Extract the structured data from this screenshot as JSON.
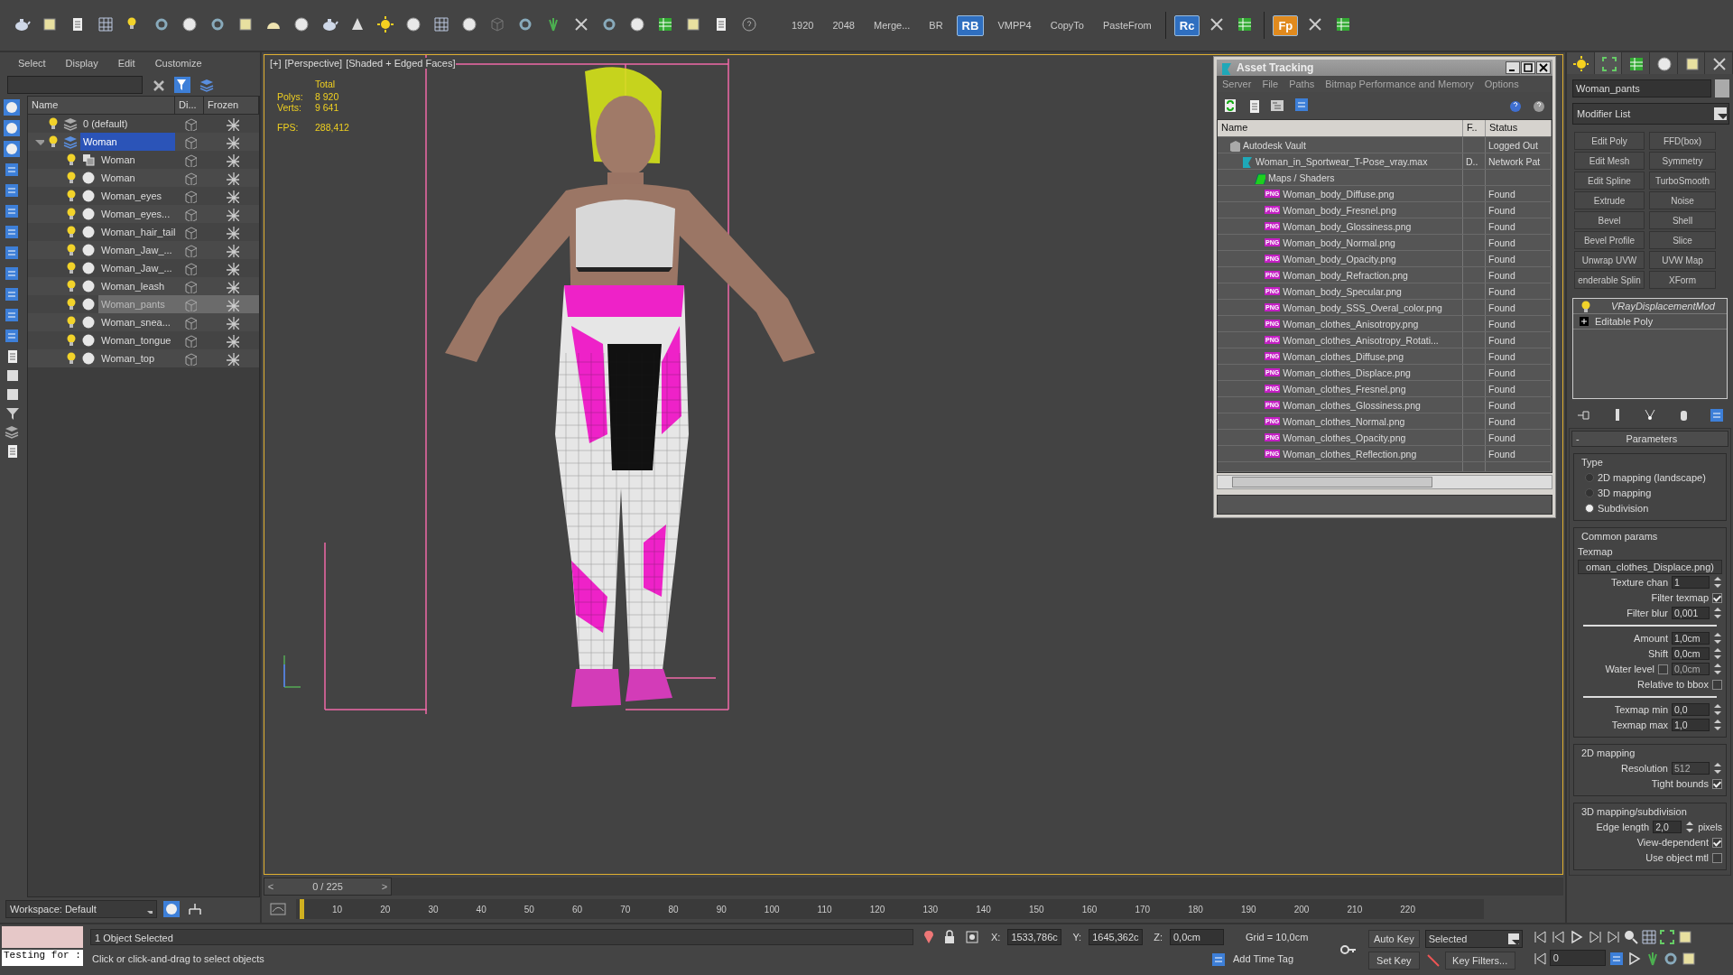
{
  "toolbar": {
    "buttons": [
      {
        "label": "1920",
        "kind": "text"
      },
      {
        "label": "2048",
        "kind": "text"
      },
      {
        "label": "Merge...",
        "kind": "text"
      },
      {
        "label": "BR",
        "kind": "text"
      },
      {
        "label": "RB",
        "kind": "badge"
      },
      {
        "label": "VMPP4",
        "kind": "text"
      },
      {
        "label": "CopyTo",
        "kind": "text"
      },
      {
        "label": "PasteFrom",
        "kind": "text"
      }
    ],
    "plugins": [
      {
        "label": "Rc",
        "color": "#2f6fc0"
      },
      {
        "label": "Fp",
        "color": "#e08a1e"
      }
    ]
  },
  "scene_explorer": {
    "menu": [
      "Select",
      "Display",
      "Edit",
      "Customize"
    ],
    "columns": [
      "Name",
      "Di...",
      "Frozen"
    ],
    "tree": [
      {
        "name": "0 (default)",
        "kind": "layer",
        "selected": false,
        "active": false
      },
      {
        "name": "Woman",
        "kind": "layer",
        "selected": false,
        "active": true,
        "expanded": true,
        "children": [
          {
            "name": "Woman",
            "kind": "group",
            "selected": false,
            "active": false
          },
          {
            "name": "Woman",
            "kind": "object",
            "selected": false,
            "active": false
          },
          {
            "name": "Woman_eyes",
            "kind": "object",
            "selected": false,
            "active": false
          },
          {
            "name": "Woman_eyes...",
            "kind": "object",
            "selected": false,
            "active": false
          },
          {
            "name": "Woman_hair_tail",
            "kind": "object",
            "selected": false,
            "active": false
          },
          {
            "name": "Woman_Jaw_...",
            "kind": "object",
            "selected": false,
            "active": false
          },
          {
            "name": "Woman_Jaw_...",
            "kind": "object",
            "selected": false,
            "active": false
          },
          {
            "name": "Woman_leash",
            "kind": "object",
            "selected": false,
            "active": false
          },
          {
            "name": "Woman_pants",
            "kind": "object",
            "selected": true,
            "active": false
          },
          {
            "name": "Woman_snea...",
            "kind": "object",
            "selected": false,
            "active": false
          },
          {
            "name": "Woman_tongue",
            "kind": "object",
            "selected": false,
            "active": false
          },
          {
            "name": "Woman_top",
            "kind": "object",
            "selected": false,
            "active": false
          }
        ]
      }
    ],
    "workspace": "Workspace: Default"
  },
  "viewport": {
    "labels": [
      "[+]",
      "[Perspective]",
      "[Shaded + Edged Faces]"
    ],
    "stats_title": "Total",
    "stats": [
      {
        "label": "Polys:",
        "value": "8 920"
      },
      {
        "label": "Verts:",
        "value": "9 641"
      }
    ],
    "fps": {
      "label": "FPS:",
      "value": "288,412"
    }
  },
  "asset_tracking": {
    "title": "Asset Tracking",
    "menu": [
      "Server",
      "File",
      "Paths",
      "Bitmap Performance and Memory",
      "Options"
    ],
    "columns": [
      "Name",
      "F..",
      "Status"
    ],
    "rows": [
      {
        "name": "Autodesk Vault",
        "kind": "vault",
        "status": "Logged Out",
        "children": [
          {
            "name": "Woman_in_Sportwear_T-Pose_vray.max",
            "kind": "scene",
            "column_2": "D..",
            "status": "Network Pat",
            "children": [
              {
                "name": "Maps / Shaders",
                "kind": "folder",
                "children": [
                  {
                    "name": "Woman_body_Diffuse.png",
                    "kind": "png",
                    "badge": "PNG",
                    "status": "Found"
                  },
                  {
                    "name": "Woman_body_Fresnel.png",
                    "kind": "png",
                    "badge": "PNG",
                    "status": "Found"
                  },
                  {
                    "name": "Woman_body_Glossiness.png",
                    "kind": "png",
                    "badge": "PNG",
                    "status": "Found"
                  },
                  {
                    "name": "Woman_body_Normal.png",
                    "kind": "png",
                    "badge": "PNG",
                    "status": "Found"
                  },
                  {
                    "name": "Woman_body_Opacity.png",
                    "kind": "png",
                    "badge": "PNG",
                    "status": "Found"
                  },
                  {
                    "name": "Woman_body_Refraction.png",
                    "kind": "png",
                    "badge": "PNG",
                    "status": "Found"
                  },
                  {
                    "name": "Woman_body_Specular.png",
                    "kind": "png",
                    "badge": "PNG",
                    "status": "Found"
                  },
                  {
                    "name": "Woman_body_SSS_Overal_color.png",
                    "kind": "png",
                    "badge": "PNG",
                    "status": "Found"
                  },
                  {
                    "name": "Woman_clothes_Anisotropy.png",
                    "kind": "png",
                    "badge": "PNG",
                    "status": "Found"
                  },
                  {
                    "name": "Woman_clothes_Anisotropy_Rotati...",
                    "kind": "png",
                    "badge": "PNG",
                    "status": "Found"
                  },
                  {
                    "name": "Woman_clothes_Diffuse.png",
                    "kind": "png",
                    "badge": "PNG",
                    "status": "Found"
                  },
                  {
                    "name": "Woman_clothes_Displace.png",
                    "kind": "png",
                    "badge": "PNG",
                    "status": "Found"
                  },
                  {
                    "name": "Woman_clothes_Fresnel.png",
                    "kind": "png",
                    "badge": "PNG",
                    "status": "Found"
                  },
                  {
                    "name": "Woman_clothes_Glossiness.png",
                    "kind": "png",
                    "badge": "PNG",
                    "status": "Found"
                  },
                  {
                    "name": "Woman_clothes_Normal.png",
                    "kind": "png",
                    "badge": "PNG",
                    "status": "Found"
                  },
                  {
                    "name": "Woman_clothes_Opacity.png",
                    "kind": "png",
                    "badge": "PNG",
                    "status": "Found"
                  },
                  {
                    "name": "Woman_clothes_Reflection.png",
                    "kind": "png",
                    "badge": "PNG",
                    "status": "Found"
                  }
                ]
              }
            ]
          }
        ]
      }
    ]
  },
  "command_panel": {
    "object_name": "Woman_pants",
    "modifier_list": "Modifier List",
    "modifier_buttons": [
      "Edit Poly",
      "FFD(box)",
      "Edit Mesh",
      "Symmetry",
      "Edit Spline",
      "TurboSmooth",
      "Extrude",
      "Noise",
      "Bevel",
      "Shell",
      "Bevel Profile",
      "Slice",
      "Unwrap UVW",
      "UVW Map",
      "enderable Splin",
      "XForm"
    ],
    "stack": [
      {
        "name": "VRayDisplacementMod",
        "kind": "modifier",
        "selected": false
      },
      {
        "name": "Editable Poly",
        "kind": "base",
        "selected": false
      }
    ],
    "rollout": {
      "title": "Parameters",
      "collapse": "-",
      "groups": [
        {
          "title": "Type",
          "rows": [
            {
              "kind": "radio",
              "label": "2D mapping (landscape)",
              "selected": false
            },
            {
              "kind": "radio",
              "label": "3D mapping",
              "selected": false
            },
            {
              "kind": "radio",
              "label": "Subdivision",
              "selected": true
            }
          ]
        },
        {
          "title": "Common params",
          "rows": [
            {
              "kind": "caption",
              "label": "Texmap"
            },
            {
              "kind": "map",
              "label": "oman_clothes_Displace.png)"
            },
            {
              "kind": "spinner",
              "label": "Texture chan",
              "value": "1",
              "disabled": false
            },
            {
              "kind": "checkbox",
              "label": "Filter texmap",
              "checked": true
            },
            {
              "kind": "spinner",
              "label": "Filter blur",
              "value": "0,001",
              "disabled": false
            },
            {
              "kind": "divider"
            },
            {
              "kind": "spinner",
              "label": "Amount",
              "value": "1,0cm",
              "disabled": false
            },
            {
              "kind": "spinner",
              "label": "Shift",
              "value": "0,0cm",
              "disabled": false
            },
            {
              "kind": "check_spinner",
              "label": "Water level",
              "checked": false,
              "value": "0,0cm",
              "disabled": true
            },
            {
              "kind": "checkbox",
              "label": "Relative to bbox",
              "checked": false
            },
            {
              "kind": "divider"
            },
            {
              "kind": "spinner",
              "label": "Texmap min",
              "value": "0,0",
              "disabled": false
            },
            {
              "kind": "spinner",
              "label": "Texmap max",
              "value": "1,0",
              "disabled": false
            }
          ]
        },
        {
          "title": "2D mapping",
          "rows": [
            {
              "kind": "spinner",
              "label": "Resolution",
              "value": "512",
              "disabled": true
            },
            {
              "kind": "checkbox",
              "label": "Tight bounds",
              "checked": true
            }
          ]
        },
        {
          "title": "3D mapping/subdivision",
          "rows": [
            {
              "kind": "spinner",
              "label": "Edge length",
              "value": "2,0",
              "unit": "pixels",
              "disabled": false
            },
            {
              "kind": "checkbox",
              "label": "View-dependent",
              "checked": true
            },
            {
              "kind": "checkbox",
              "label": "Use object mtl",
              "checked": false
            }
          ]
        }
      ]
    }
  },
  "timeline": {
    "frame": "0 / 225",
    "level": 0,
    "prev": "<",
    "next": ">",
    "ticks": [
      "10",
      "20",
      "30",
      "40",
      "50",
      "60",
      "70",
      "80",
      "90",
      "100",
      "110",
      "120",
      "130",
      "140",
      "150",
      "160",
      "170",
      "180",
      "190",
      "200",
      "210",
      "220"
    ]
  },
  "status_bar": {
    "listener": "Testing for :",
    "selection": "1 Object Selected",
    "prompt": "Click or click-and-drag to select objects",
    "coords": [
      {
        "label": "X:",
        "value": "1533,786c"
      },
      {
        "label": "Y:",
        "value": "1645,362c"
      },
      {
        "label": "Z:",
        "value": "0,0cm"
      }
    ],
    "grid": "Grid = 10,0cm",
    "time_tag": "Add Time Tag",
    "auto_key": "Auto Key",
    "set_key": "Set Key",
    "key_mode": "Selected",
    "key_filters": "Key Filters...",
    "frame": "0"
  }
}
